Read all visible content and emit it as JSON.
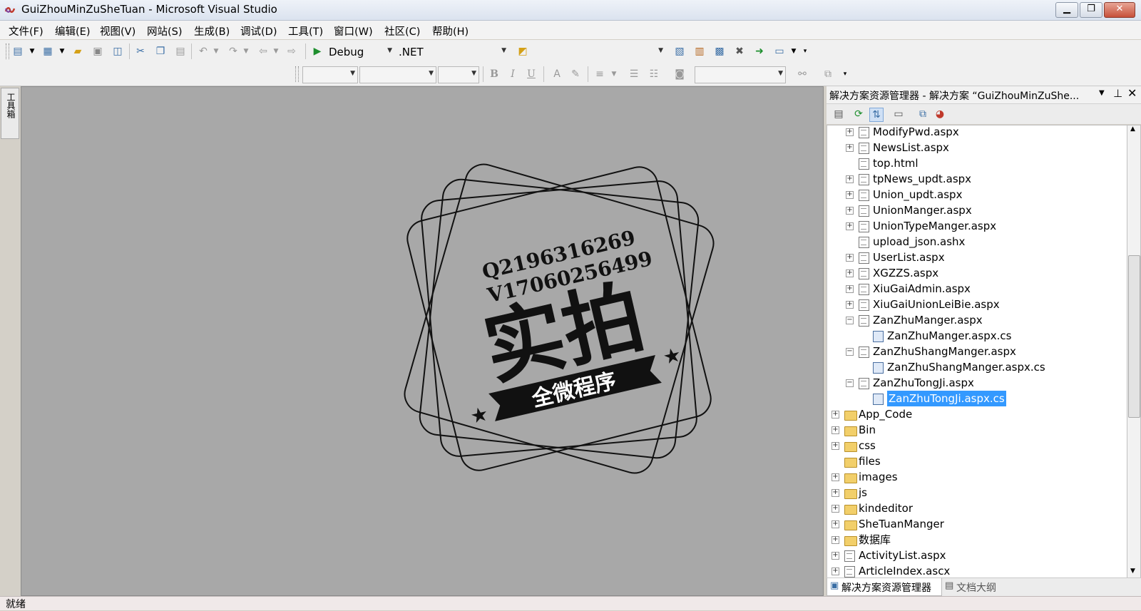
{
  "window": {
    "title": "GuiZhouMinZuSheTuan - Microsoft Visual Studio",
    "controls": {
      "minimize": "▁",
      "restore": "❐",
      "close": "✕"
    }
  },
  "menu": [
    "文件(F)",
    "编辑(E)",
    "视图(V)",
    "网站(S)",
    "生成(B)",
    "调试(D)",
    "工具(T)",
    "窗口(W)",
    "社区(C)",
    "帮助(H)"
  ],
  "toolbar": {
    "config": "Debug",
    "platform": ".NET",
    "format_buttons": {
      "bold": "B",
      "italic": "I",
      "underline": "U"
    }
  },
  "toolbox": {
    "label": "工具箱"
  },
  "watermark": {
    "qq": "Q2196316269",
    "wechat": "V17060256499",
    "big_text": "实拍",
    "banner": "全微程序"
  },
  "solution_explorer": {
    "title": "解决方案资源管理器 - 解决方案 “GuiZhouMinZuShe...",
    "tree": [
      {
        "label": "ModifyPwd.aspx",
        "level": 2,
        "icon": "page",
        "exp": "+"
      },
      {
        "label": "NewsList.aspx",
        "level": 2,
        "icon": "page",
        "exp": "+"
      },
      {
        "label": "top.html",
        "level": 2,
        "icon": "page",
        "exp": ""
      },
      {
        "label": "tpNews_updt.aspx",
        "level": 2,
        "icon": "page",
        "exp": "+"
      },
      {
        "label": "Union_updt.aspx",
        "level": 2,
        "icon": "page",
        "exp": "+"
      },
      {
        "label": "UnionManger.aspx",
        "level": 2,
        "icon": "page",
        "exp": "+"
      },
      {
        "label": "UnionTypeManger.aspx",
        "level": 2,
        "icon": "page",
        "exp": "+"
      },
      {
        "label": "upload_json.ashx",
        "level": 2,
        "icon": "page",
        "exp": ""
      },
      {
        "label": "UserList.aspx",
        "level": 2,
        "icon": "page",
        "exp": "+"
      },
      {
        "label": "XGZZS.aspx",
        "level": 2,
        "icon": "page",
        "exp": "+"
      },
      {
        "label": "XiuGaiAdmin.aspx",
        "level": 2,
        "icon": "page",
        "exp": "+"
      },
      {
        "label": "XiuGaiUnionLeiBie.aspx",
        "level": 2,
        "icon": "page",
        "exp": "+"
      },
      {
        "label": "ZanZhuManger.aspx",
        "level": 2,
        "icon": "page",
        "exp": "−"
      },
      {
        "label": "ZanZhuManger.aspx.cs",
        "level": 3,
        "icon": "cs",
        "exp": ""
      },
      {
        "label": "ZanZhuShangManger.aspx",
        "level": 2,
        "icon": "page",
        "exp": "−"
      },
      {
        "label": "ZanZhuShangManger.aspx.cs",
        "level": 3,
        "icon": "cs",
        "exp": ""
      },
      {
        "label": "ZanZhuTongJi.aspx",
        "level": 2,
        "icon": "page",
        "exp": "−"
      },
      {
        "label": "ZanZhuTongJi.aspx.cs",
        "level": 3,
        "icon": "cs",
        "exp": "",
        "selected": true
      },
      {
        "label": "App_Code",
        "level": 1,
        "icon": "folder",
        "exp": "+"
      },
      {
        "label": "Bin",
        "level": 1,
        "icon": "folder",
        "exp": "+"
      },
      {
        "label": "css",
        "level": 1,
        "icon": "folder",
        "exp": "+"
      },
      {
        "label": "files",
        "level": 1,
        "icon": "folder",
        "exp": ""
      },
      {
        "label": "images",
        "level": 1,
        "icon": "folder",
        "exp": "+"
      },
      {
        "label": "js",
        "level": 1,
        "icon": "folder",
        "exp": "+"
      },
      {
        "label": "kindeditor",
        "level": 1,
        "icon": "folder",
        "exp": "+"
      },
      {
        "label": "SheTuanManger",
        "level": 1,
        "icon": "folder",
        "exp": "+"
      },
      {
        "label": "数据库",
        "level": 1,
        "icon": "folder",
        "exp": "+"
      },
      {
        "label": "ActivityList.aspx",
        "level": 1,
        "icon": "page",
        "exp": "+"
      },
      {
        "label": "ArticleIndex.ascx",
        "level": 1,
        "icon": "page",
        "exp": "+"
      }
    ],
    "tabs": {
      "active": "解决方案资源管理器",
      "other": "文档大纲"
    }
  },
  "status": {
    "text": "就绪"
  }
}
